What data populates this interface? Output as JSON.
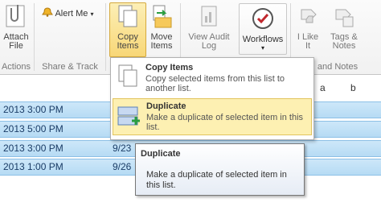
{
  "ribbon": {
    "attach_file": "Attach\nFile",
    "alert_me": "Alert Me",
    "copy_items": "Copy\nItems",
    "move_items": "Move\nItems",
    "view_audit_log": "View Audit\nLog",
    "workflows": "Workflows",
    "i_like_it": "I Like\nIt",
    "tags_notes": "Tags &\nNotes"
  },
  "groups": {
    "actions": "Actions",
    "share_track": "Share & Track",
    "tags_notes": "and Notes"
  },
  "columns": {
    "a": "a",
    "b": "b"
  },
  "rows": [
    {
      "date": "2013 3:00 PM",
      "date2": ""
    },
    {
      "date": "2013 5:00 PM",
      "date2": ""
    },
    {
      "date": "2013 3:00 PM",
      "date2": "9/23"
    },
    {
      "date": "2013 1:00 PM",
      "date2": "9/26"
    }
  ],
  "menu": {
    "items": [
      {
        "title": "Copy Items",
        "description": "Copy selected items from this list to another list."
      },
      {
        "title": "Duplicate",
        "description": "Make a duplicate of selected item in this list."
      }
    ]
  },
  "tooltip": {
    "title": "Duplicate",
    "description": "Make a duplicate of selected item in this list."
  },
  "colors": {
    "highlight": "#fdf0b2",
    "row": "#cde7f9",
    "accent": "#1a3c66"
  }
}
